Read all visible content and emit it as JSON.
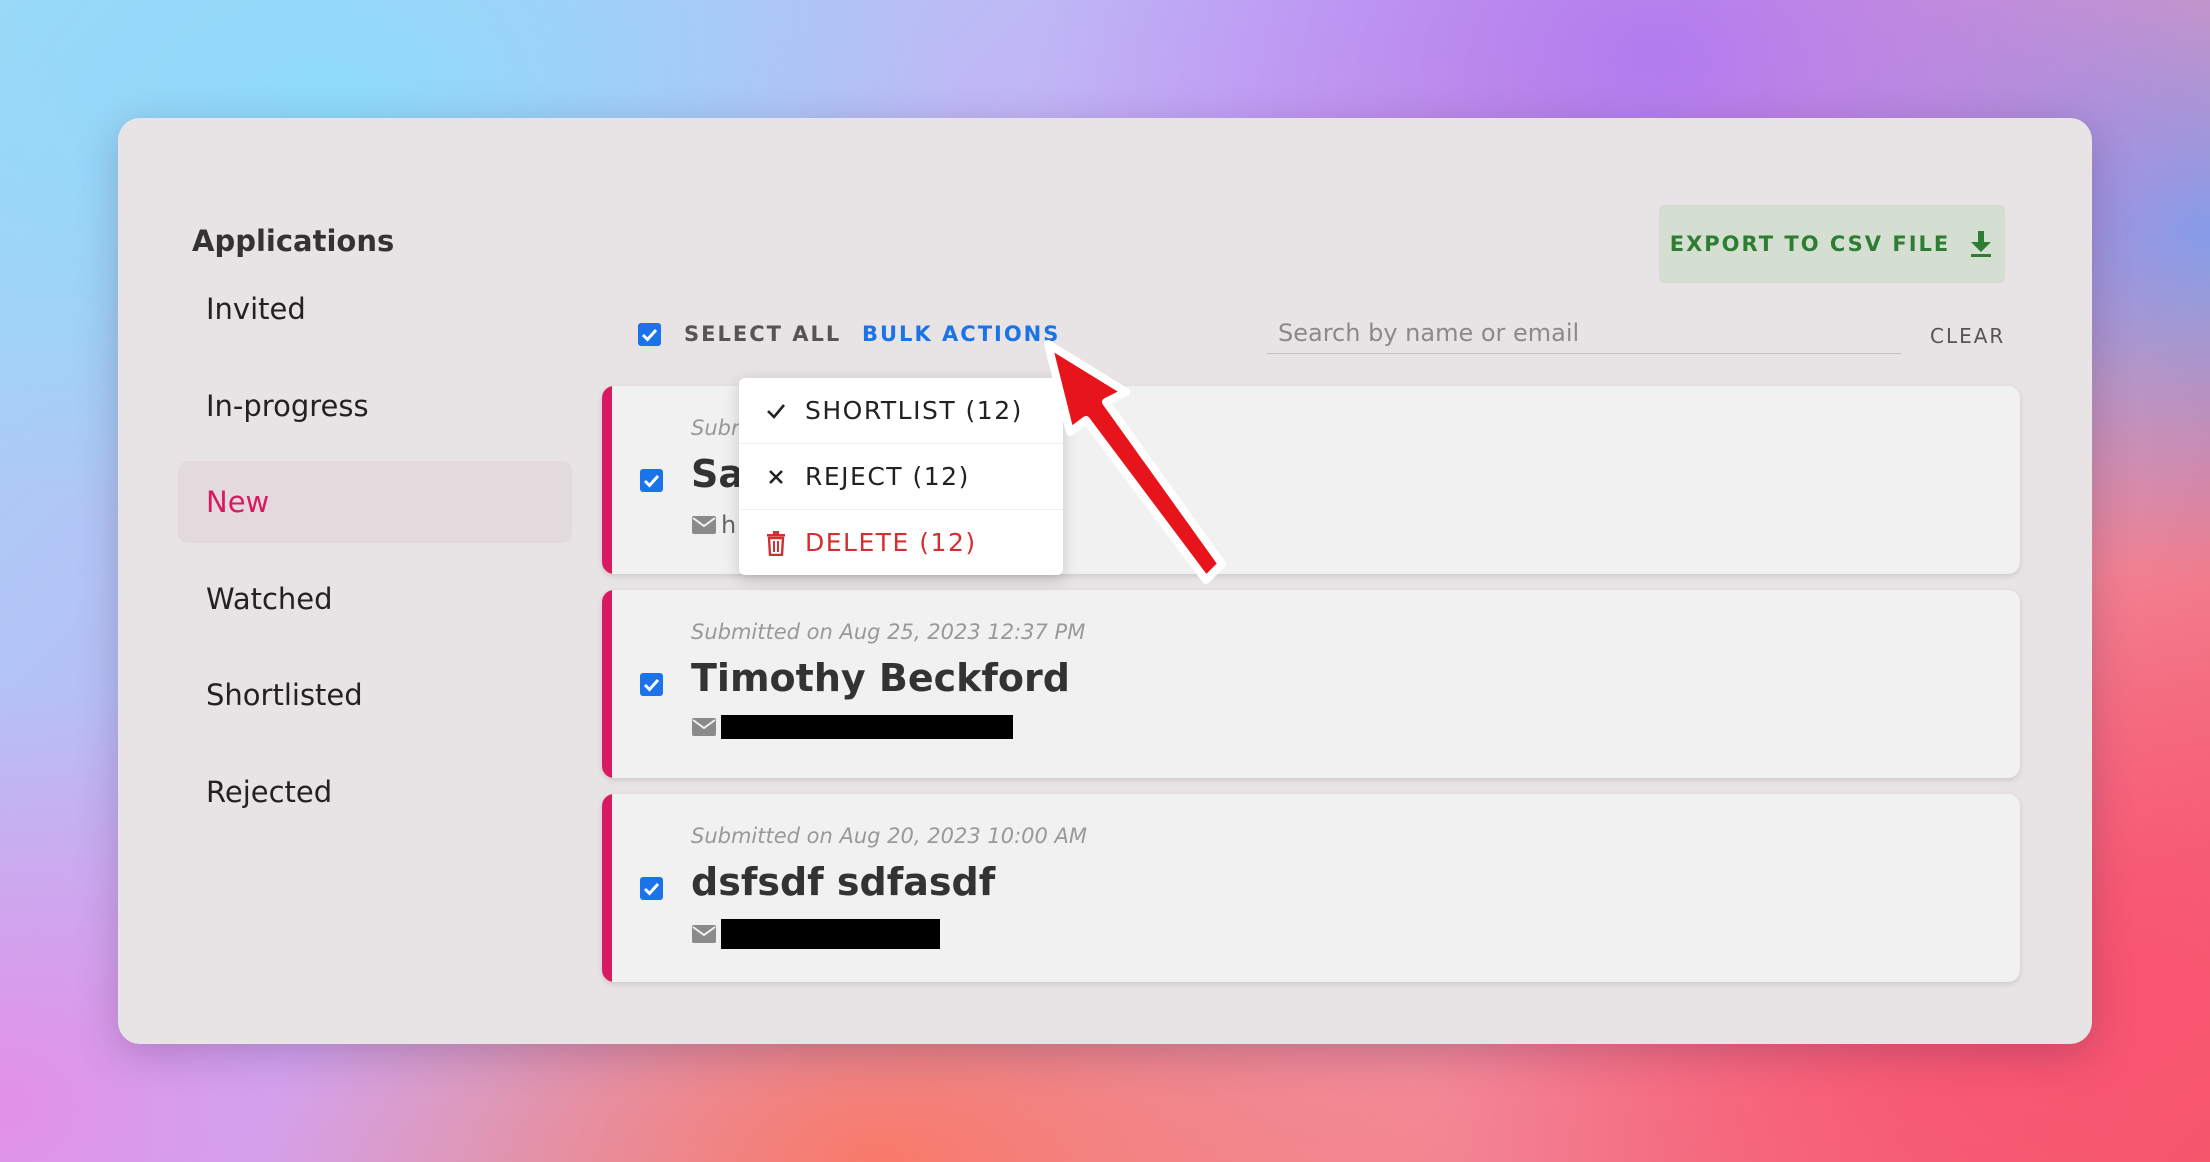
{
  "sidebar": {
    "title": "Applications",
    "items": [
      {
        "label": "Invited"
      },
      {
        "label": "In-progress"
      },
      {
        "label": "New",
        "active": true
      },
      {
        "label": "Watched"
      },
      {
        "label": "Shortlisted"
      },
      {
        "label": "Rejected"
      }
    ]
  },
  "toolbar": {
    "export_label": "EXPORT TO CSV FILE",
    "select_all_label": "SELECT ALL",
    "bulk_actions_label": "BULK ACTIONS",
    "search_placeholder": "Search by name or email",
    "clear_label": "CLEAR"
  },
  "bulk_menu": {
    "items": [
      {
        "label": "SHORTLIST (12)",
        "icon": "check-icon"
      },
      {
        "label": "REJECT (12)",
        "icon": "close-icon"
      },
      {
        "label": "DELETE (12)",
        "icon": "trash-icon"
      }
    ]
  },
  "applications": [
    {
      "submitted": "Subr",
      "name": "Sa",
      "email": "h",
      "checked": true
    },
    {
      "submitted": "Submitted on Aug 25, 2023 12:37 PM",
      "name": "Timothy Beckford",
      "email": "",
      "checked": true
    },
    {
      "submitted": "Submitted on Aug 20, 2023 10:00 AM",
      "name": "dsfsdf sdfasdf",
      "email": "",
      "checked": true
    }
  ],
  "colors": {
    "accent": "#d81b60",
    "primary": "#1a73e8",
    "export": "#2e7d32",
    "danger": "#d32f2f",
    "annotation_arrow": "#e8141c"
  }
}
